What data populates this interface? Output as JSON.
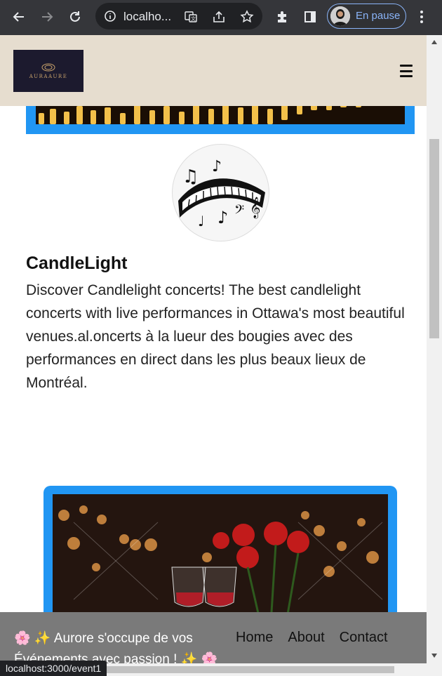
{
  "browser": {
    "url": "localho...",
    "profile_label": "En pause"
  },
  "header": {
    "logo_text": "AURAAURE"
  },
  "event": {
    "title": "CandleLight",
    "description": "Discover Candlelight concerts! The best candlelight concerts with live performances in Ottawa's most beautiful venues.al.oncerts à la lueur des bougies avec des performances en direct dans les plus beaux lieux de Montréal."
  },
  "footer": {
    "message": "🌸 ✨ Aurore s'occupe de vos Événements avec passion ! ✨ 🌸",
    "links": [
      {
        "label": "Home"
      },
      {
        "label": "About"
      },
      {
        "label": "Contact"
      }
    ]
  },
  "status_bar": {
    "link_preview": "localhost:3000/event1"
  },
  "colors": {
    "header_bg": "#e6ddcf",
    "frame_blue": "#2196f3",
    "footer_bg": "#7a7a7a"
  }
}
